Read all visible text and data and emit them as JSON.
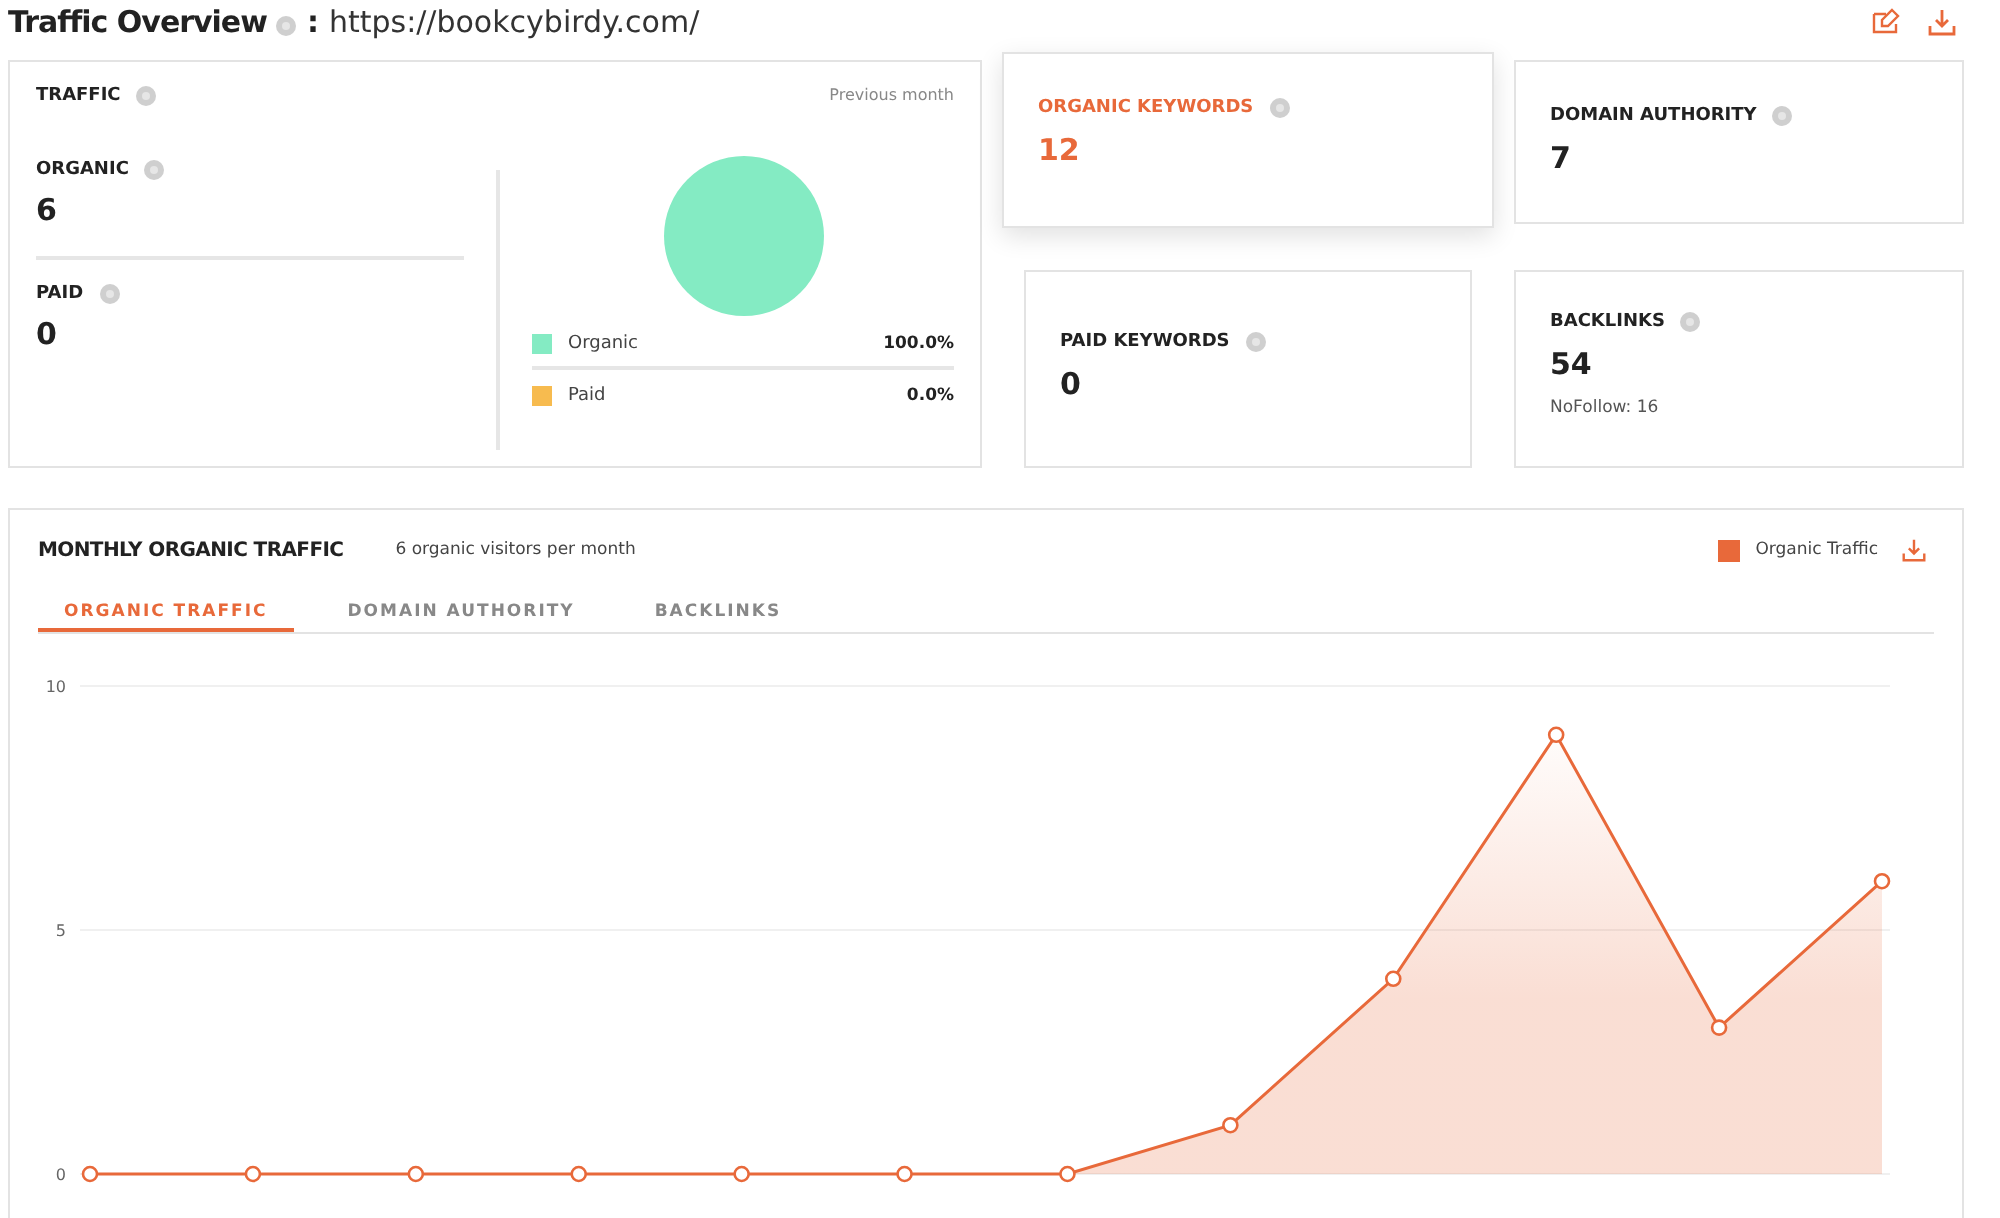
{
  "header": {
    "title": "Traffic Overview",
    "separator": ":",
    "url": "https://bookcybirdy.com/"
  },
  "traffic": {
    "title": "TRAFFIC",
    "period": "Previous month",
    "metrics": [
      {
        "label": "ORGANIC",
        "value": "6"
      },
      {
        "label": "PAID",
        "value": "0"
      }
    ],
    "chart_data": {
      "type": "pie",
      "categories": [
        "Organic",
        "Paid"
      ],
      "values": [
        100,
        0
      ],
      "value_labels": [
        "100.0%",
        "0.0%"
      ],
      "colors": [
        "#84ebc3",
        "#f7bb4f"
      ]
    }
  },
  "stats": [
    {
      "label": "ORGANIC KEYWORDS",
      "value": "12",
      "selected": true
    },
    {
      "label": "DOMAIN AUTHORITY",
      "value": "7",
      "selected": false
    },
    {
      "label": "PAID KEYWORDS",
      "value": "0",
      "selected": false
    },
    {
      "label": "BACKLINKS",
      "value": "54",
      "note": "NoFollow: 16",
      "selected": false
    }
  ],
  "monthly": {
    "title": "MONTHLY ORGANIC TRAFFIC",
    "subtitle": "6 organic visitors per month",
    "tabs": [
      {
        "label": "ORGANIC TRAFFIC",
        "selected": true
      },
      {
        "label": "DOMAIN AUTHORITY",
        "selected": false
      },
      {
        "label": "BACKLINKS",
        "selected": false
      }
    ],
    "chart_data": {
      "type": "area",
      "series": [
        {
          "name": "Organic Traffic",
          "color": "#e8693a",
          "values": [
            0,
            0,
            0,
            0,
            0,
            0,
            0,
            1,
            4,
            9,
            3,
            6
          ]
        }
      ],
      "ylim": [
        0,
        10
      ],
      "yticks": [
        0,
        5,
        10
      ]
    }
  }
}
